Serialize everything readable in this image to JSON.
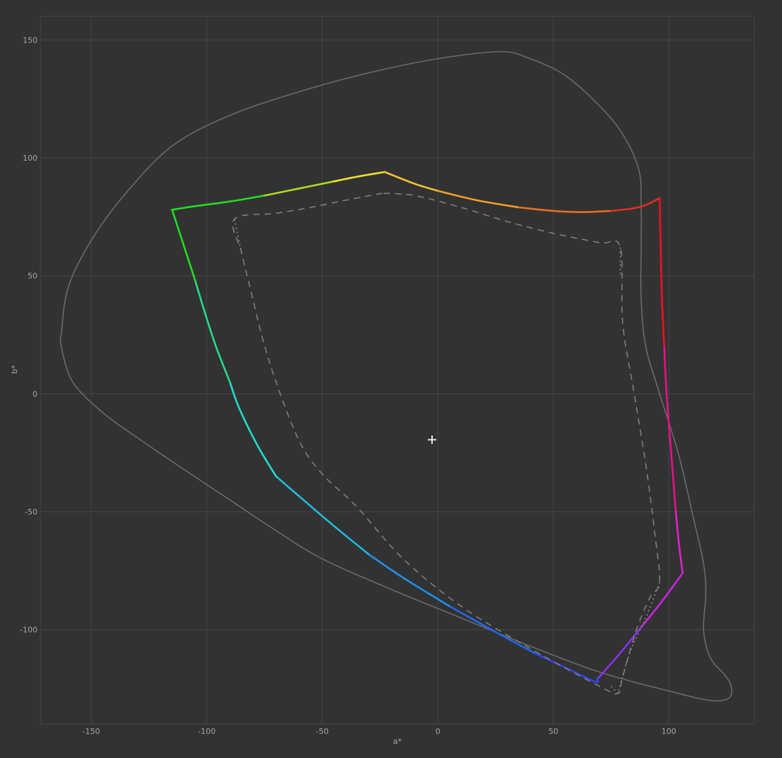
{
  "chart_data": {
    "type": "line",
    "xlabel": "a*",
    "ylabel": "b*",
    "xlim": [
      -172,
      137
    ],
    "ylim": [
      -140,
      160
    ],
    "x_ticks": [
      -150,
      -100,
      -50,
      0,
      50,
      100
    ],
    "x_tick_labels": [
      "-150",
      "-100",
      "-50",
      "0",
      "50",
      "100"
    ],
    "y_ticks": [
      -100,
      -50,
      0,
      50,
      100,
      150
    ],
    "y_tick_labels": [
      "-100",
      "-50",
      "0",
      "50",
      "100",
      "150"
    ],
    "grid": true,
    "colors": {
      "background": "#323232",
      "grid": "#454545",
      "locus": "#6a6a6a",
      "dashed_gamut": "#7e7e7e",
      "dotted_gamut": "#8a8a8a",
      "tick_label": "#a5a5a5",
      "marker": "#e8e8e8"
    },
    "spectral_locus": {
      "style": "solid-gray",
      "points": [
        [
          -163,
          25
        ],
        [
          -163,
          20
        ],
        [
          -158,
          5
        ],
        [
          -145,
          -8
        ],
        [
          -128,
          -20
        ],
        [
          -110,
          -32
        ],
        [
          -90,
          -45
        ],
        [
          -70,
          -58
        ],
        [
          -50,
          -70
        ],
        [
          -20,
          -83
        ],
        [
          10,
          -95
        ],
        [
          40,
          -107
        ],
        [
          70,
          -118
        ],
        [
          100,
          -126
        ],
        [
          118,
          -130
        ],
        [
          126,
          -129
        ],
        [
          127,
          -124
        ],
        [
          124,
          -119
        ],
        [
          118,
          -112
        ],
        [
          115,
          -100
        ],
        [
          116,
          -85
        ],
        [
          115,
          -72
        ],
        [
          110,
          -50
        ],
        [
          104,
          -25
        ],
        [
          96,
          0
        ],
        [
          90,
          20
        ],
        [
          88,
          40
        ],
        [
          88,
          60
        ],
        [
          88,
          80
        ],
        [
          87,
          95
        ],
        [
          80,
          110
        ],
        [
          70,
          122
        ],
        [
          55,
          135
        ],
        [
          40,
          142
        ],
        [
          27,
          145
        ],
        [
          0,
          142
        ],
        [
          -30,
          136
        ],
        [
          -60,
          128
        ],
        [
          -90,
          118
        ],
        [
          -115,
          105
        ],
        [
          -135,
          85
        ],
        [
          -150,
          65
        ],
        [
          -160,
          45
        ],
        [
          -163,
          25
        ]
      ]
    },
    "gamut_curves": [
      {
        "style": "gradient-solid",
        "segments": [
          {
            "color": "#22dd22",
            "points": [
              [
                -115,
                78
              ],
              [
                -105,
                79.5
              ],
              [
                -90,
                81.5
              ],
              [
                -75,
                84
              ]
            ]
          },
          {
            "color": "#aadd22",
            "points": [
              [
                -75,
                84
              ],
              [
                -60,
                87
              ],
              [
                -45,
                90
              ]
            ]
          },
          {
            "color": "#eedd33",
            "points": [
              [
                -45,
                90
              ],
              [
                -35,
                92
              ],
              [
                -23,
                94
              ]
            ]
          },
          {
            "color": "#f5c233",
            "points": [
              [
                -23,
                94
              ],
              [
                -10,
                89
              ],
              [
                0,
                86
              ]
            ]
          },
          {
            "color": "#f0a02a",
            "points": [
              [
                0,
                86
              ],
              [
                17,
                82
              ],
              [
                35,
                79
              ]
            ]
          },
          {
            "color": "#e87020",
            "points": [
              [
                35,
                79
              ],
              [
                50,
                77.5
              ],
              [
                62,
                77
              ],
              [
                75,
                77.5
              ]
            ]
          },
          {
            "color": "#e03020",
            "points": [
              [
                75,
                77.5
              ],
              [
                84,
                78.5
              ],
              [
                90,
                80
              ],
              [
                96,
                83
              ]
            ]
          },
          {
            "color": "#ee1020",
            "points": [
              [
                96,
                83
              ],
              [
                96.5,
                60
              ],
              [
                97,
                40
              ],
              [
                98,
                20
              ]
            ]
          },
          {
            "color": "#e8108a",
            "points": [
              [
                98,
                20
              ],
              [
                99,
                0
              ],
              [
                101,
                -25
              ],
              [
                103,
                -50
              ]
            ]
          },
          {
            "color": "#dd22cc",
            "points": [
              [
                103,
                -50
              ],
              [
                104.5,
                -65
              ],
              [
                106,
                -76
              ]
            ]
          },
          {
            "color": "#cc22dd",
            "points": [
              [
                106,
                -76
              ],
              [
                97,
                -88
              ],
              [
                88,
                -99
              ]
            ]
          },
          {
            "color": "#8833ee",
            "points": [
              [
                88,
                -99
              ],
              [
                78,
                -111
              ],
              [
                69,
                -121
              ]
            ]
          },
          {
            "color": "#3344ee",
            "points": [
              [
                69,
                -121
              ],
              [
                68,
                -122
              ],
              [
                55,
                -116
              ],
              [
                42,
                -110
              ]
            ]
          },
          {
            "color": "#2266ee",
            "points": [
              [
                42,
                -110
              ],
              [
                25,
                -101
              ],
              [
                5,
                -90
              ]
            ]
          },
          {
            "color": "#1e90ee",
            "points": [
              [
                5,
                -90
              ],
              [
                -15,
                -78
              ],
              [
                -30,
                -68
              ]
            ]
          },
          {
            "color": "#1fbbdd",
            "points": [
              [
                -30,
                -68
              ],
              [
                -45,
                -56
              ],
              [
                -57,
                -46
              ],
              [
                -70,
                -35
              ]
            ]
          },
          {
            "color": "#22ddcc",
            "points": [
              [
                -70,
                -35
              ],
              [
                -78,
                -22
              ],
              [
                -86,
                -6
              ],
              [
                -90,
                5
              ]
            ]
          },
          {
            "color": "#22dd88",
            "points": [
              [
                -90,
                5
              ],
              [
                -96,
                20
              ],
              [
                -101,
                35
              ],
              [
                -105,
                48
              ]
            ]
          },
          {
            "color": "#22dd22",
            "points": [
              [
                -105,
                48
              ],
              [
                -109,
                60
              ],
              [
                -113,
                72
              ],
              [
                -115,
                78
              ]
            ]
          }
        ]
      },
      {
        "style": "dashed-gray",
        "points": [
          [
            -24,
            85
          ],
          [
            -40,
            82
          ],
          [
            -55,
            79
          ],
          [
            -70,
            76.5
          ],
          [
            -88,
            74
          ],
          [
            -85,
            60
          ],
          [
            -81,
            44
          ],
          [
            -76,
            24
          ],
          [
            -70,
            5
          ],
          [
            -60,
            -20
          ],
          [
            -50,
            -34
          ],
          [
            -35,
            -48
          ],
          [
            -15,
            -70
          ],
          [
            10,
            -90
          ],
          [
            40,
            -108
          ],
          [
            70,
            -124
          ],
          [
            78,
            -127
          ],
          [
            80,
            -120
          ],
          [
            86,
            -100
          ],
          [
            92,
            -86
          ],
          [
            96,
            -80
          ],
          [
            94,
            -60
          ],
          [
            90,
            -30
          ],
          [
            85,
            0
          ],
          [
            80,
            30
          ],
          [
            79,
            62
          ],
          [
            70,
            64
          ],
          [
            50,
            68
          ],
          [
            30,
            73
          ],
          [
            10,
            79
          ],
          [
            -10,
            84
          ],
          [
            -24,
            85
          ]
        ]
      },
      {
        "style": "dotted-gray",
        "points": [
          [
            -88,
            74
          ],
          [
            -85,
            60
          ]
        ]
      },
      {
        "style": "dotted-gray",
        "points": [
          [
            96,
            -80
          ],
          [
            90,
            -95
          ],
          [
            83,
            -110
          ],
          [
            78,
            -127
          ]
        ]
      },
      {
        "style": "dotted-gray",
        "points": [
          [
            78,
            -127
          ],
          [
            75,
            -124
          ]
        ]
      },
      {
        "style": "dotted-gray",
        "points": [
          [
            79,
            62
          ],
          [
            79,
            50
          ]
        ]
      }
    ],
    "white_point": [
      -2.5,
      -19.5
    ]
  }
}
